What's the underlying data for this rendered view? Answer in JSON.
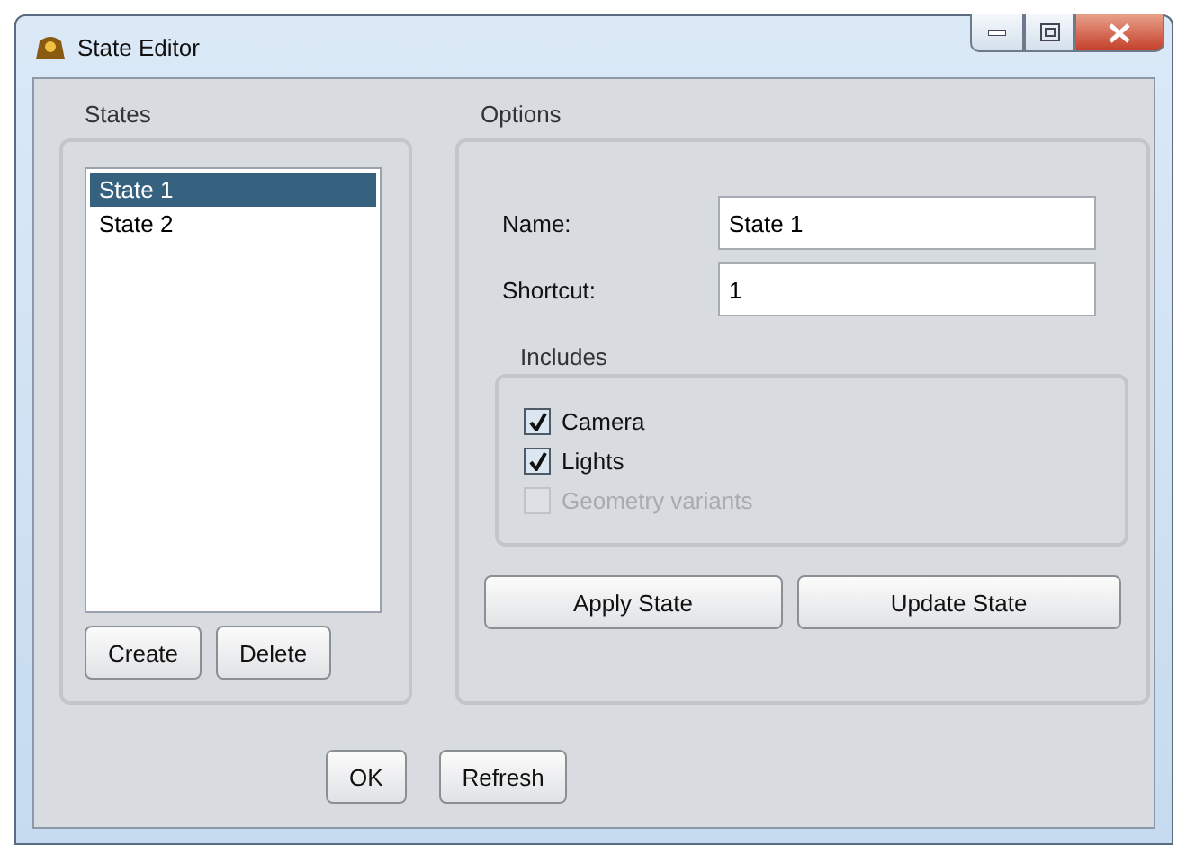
{
  "window": {
    "title": "State Editor"
  },
  "states": {
    "title": "States",
    "items": [
      {
        "label": "State 1",
        "selected": true
      },
      {
        "label": "State 2",
        "selected": false
      }
    ],
    "buttons": [
      "Create",
      "Delete"
    ]
  },
  "options": {
    "title": "Options",
    "fields": [
      {
        "label": "Name:",
        "value": "State 1"
      },
      {
        "label": "Shortcut:",
        "value": "1"
      }
    ],
    "includes": {
      "title": "Includes",
      "items": [
        {
          "label": "Camera",
          "checked": true,
          "disabled": false
        },
        {
          "label": "Lights",
          "checked": true,
          "disabled": false
        },
        {
          "label": "Geometry variants",
          "checked": false,
          "disabled": true
        }
      ]
    },
    "buttons": [
      "Apply State",
      "Update State"
    ]
  },
  "buttons": [
    "OK",
    "Refresh"
  ]
}
